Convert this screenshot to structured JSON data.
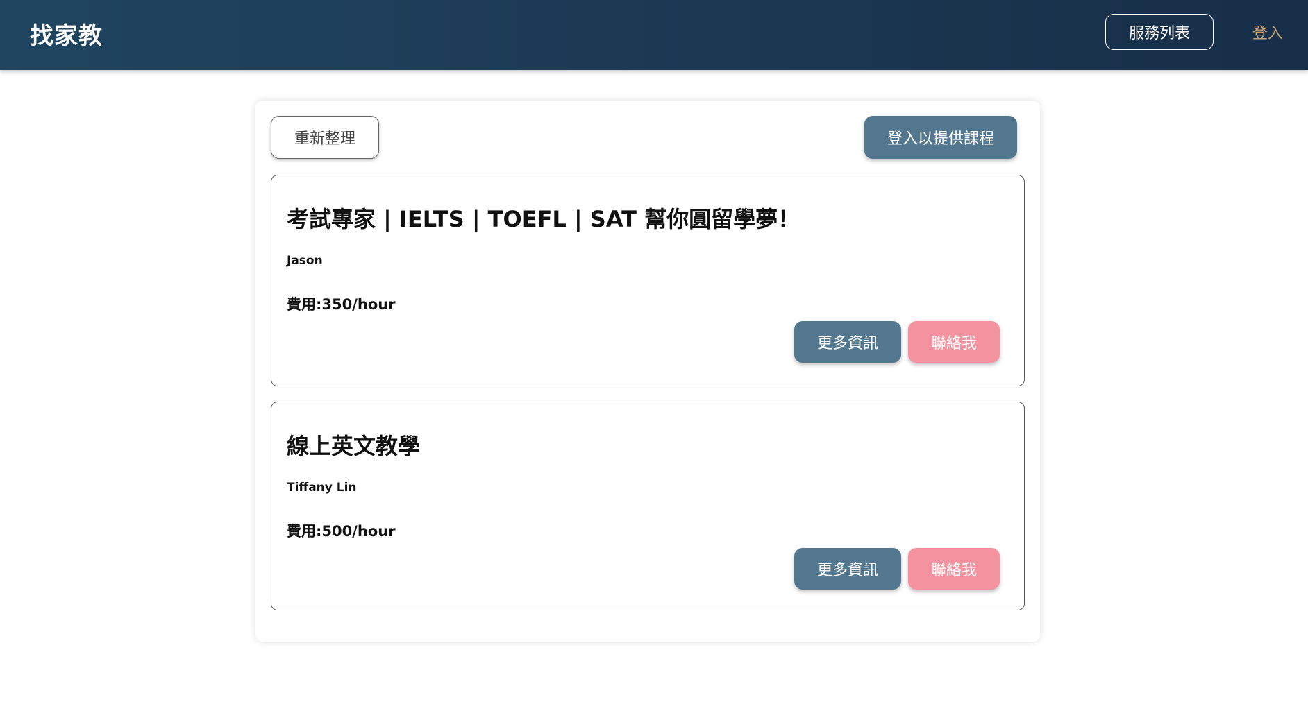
{
  "header": {
    "brand": "找家教",
    "services_label": "服務列表",
    "login_label": "登入"
  },
  "toolbar": {
    "refresh_label": "重新整理",
    "offer_label": "登入以提供課程"
  },
  "courses": [
    {
      "title": "考試專家 | IELTS | TOEFL | SAT 幫你圓留學夢！",
      "tutor": "Jason",
      "fee_label": "費用:",
      "fee_value": "350/hour",
      "more_label": "更多資訊",
      "contact_label": "聯絡我"
    },
    {
      "title": "線上英文教學",
      "tutor": "Tiffany Lin",
      "fee_label": "費用:",
      "fee_value": "500/hour",
      "more_label": "更多資訊",
      "contact_label": "聯絡我"
    }
  ],
  "colors": {
    "header_bg": "#1d3a55",
    "primary_button": "#53778e",
    "contact_button": "#f4939f",
    "login_link": "#c8a27a"
  }
}
